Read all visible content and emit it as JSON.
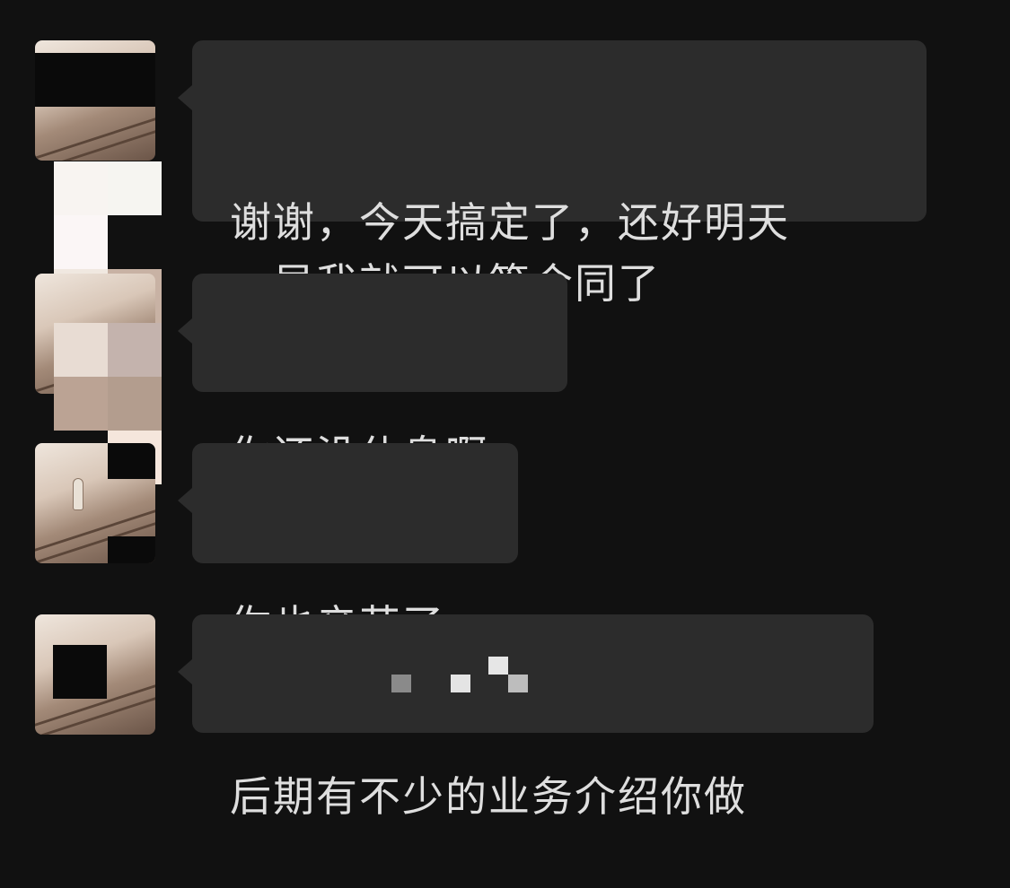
{
  "messages": [
    {
      "text": "谢谢，今天搞定了，还好明天\n一早我就可以签合同了"
    },
    {
      "text": "你还没休息啊"
    },
    {
      "text": "你也辛苦了"
    },
    {
      "text": "后期有不少的业务介绍你做"
    }
  ],
  "icons": [
    "contact-avatar"
  ],
  "colors": {
    "background": "#111111",
    "bubble": "#2c2c2c",
    "text": "#dedede"
  }
}
